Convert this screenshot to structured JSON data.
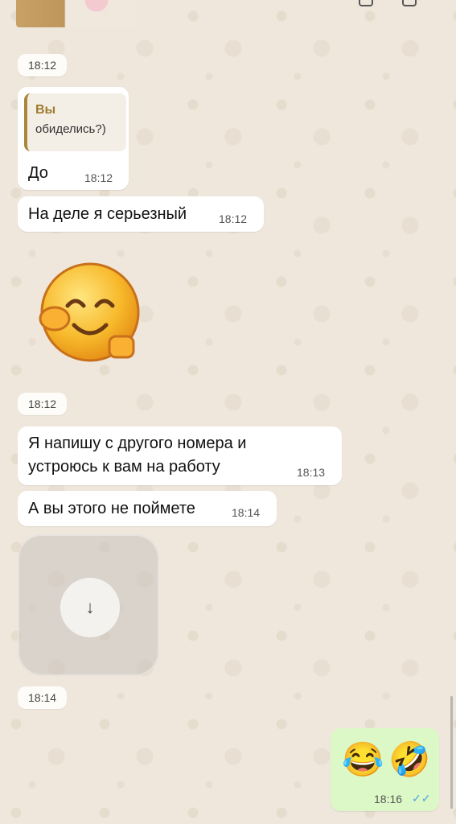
{
  "chat": {
    "time_1": "18:12",
    "reply": {
      "quote_author": "Вы",
      "quote_text": "обиделись?)",
      "text": "До",
      "time": "18:12"
    },
    "msg_serious": {
      "text": "На деле я серьезный",
      "time": "18:12"
    },
    "sticker_time": "18:12",
    "msg_job": {
      "line1": "Я напишу с другого номера и",
      "line2": "устроюсь к вам на работу",
      "time": "18:13"
    },
    "msg_understand": {
      "text": "А вы этого не поймете",
      "time": "18:14"
    },
    "video_time": "18:14",
    "outgoing": {
      "emoji_1": "😂",
      "emoji_2": "🤣",
      "time": "18:16",
      "ticks": "✓✓"
    }
  },
  "icons": {
    "download": "arrow-down-icon",
    "sticker": "smiling-face-sticker",
    "read_receipt": "double-check-icon"
  },
  "colors": {
    "background": "#efe7dc",
    "incoming_bubble": "#ffffff",
    "outgoing_bubble": "#dcf8c6",
    "quote_accent": "#9b7b2d",
    "read_tick": "#4fa3e6"
  }
}
